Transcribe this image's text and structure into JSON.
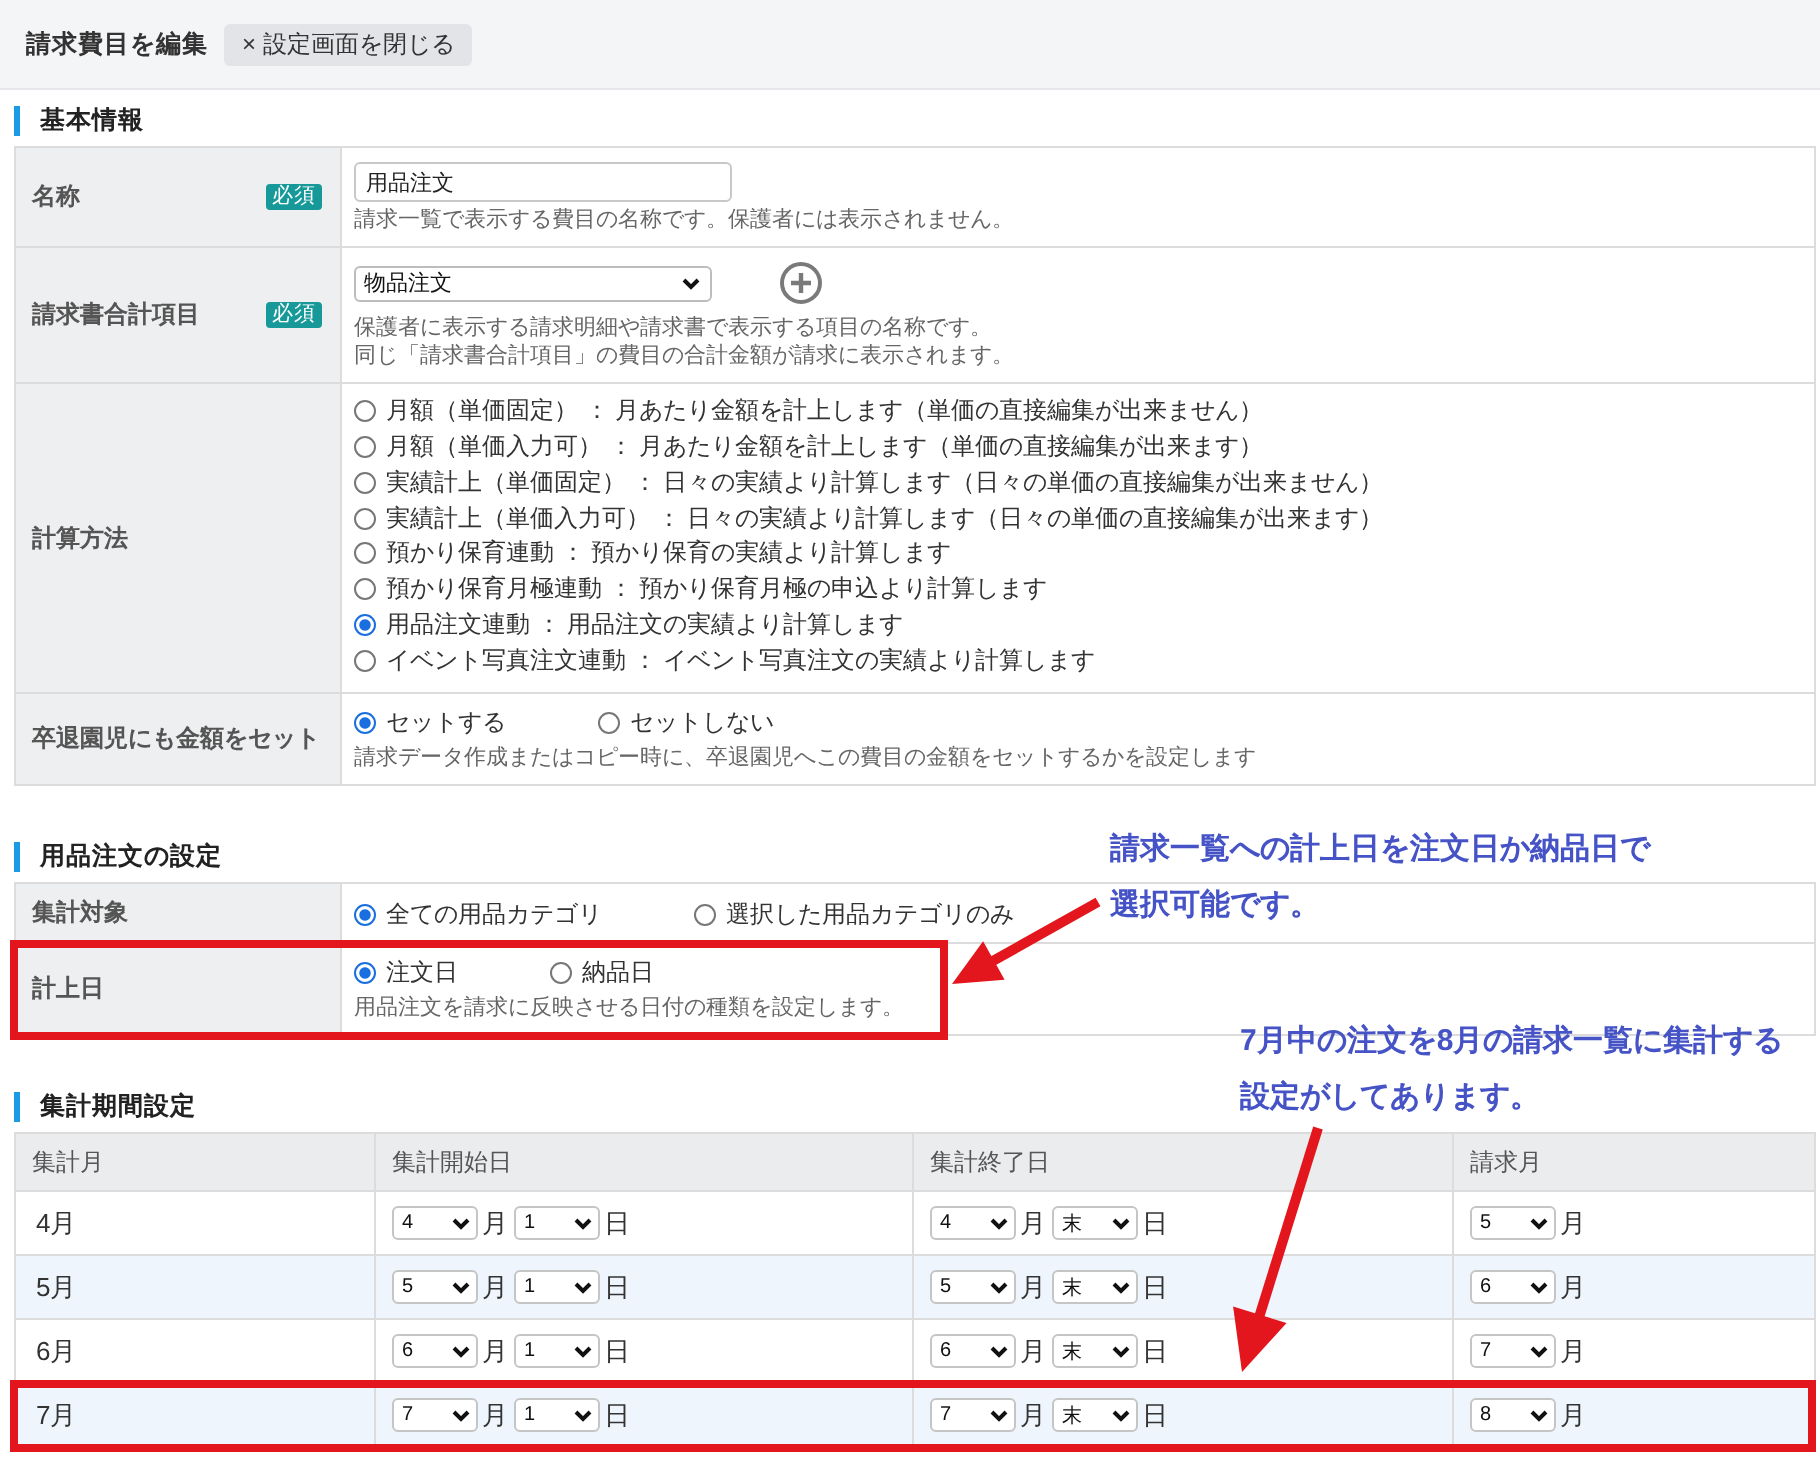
{
  "header": {
    "title": "請求費目を編集",
    "close_button": "× 設定画面を閉じる"
  },
  "sections": [
    {
      "title": "基本情報",
      "kind": "form",
      "rows": [
        {
          "kind": "input",
          "label": "名称",
          "badge": "必須",
          "value": "用品注文",
          "hint": [
            "請求一覧で表示する費目の名称です。保護者には表示されません。"
          ],
          "highlighted": false
        },
        {
          "kind": "select",
          "label": "請求書合計項目",
          "badge": "必須",
          "value": "物品注文",
          "add_button": true,
          "hint": [
            "保護者に表示する請求明細や請求書で表示する項目の名称です。",
            "同じ「請求書合計項目」の費目の合計金額が請求に表示されます。"
          ],
          "highlighted": false
        },
        {
          "kind": "radio_list",
          "label": "計算方法",
          "options": [
            {
              "label": "月額（単価固定） ： 月あたり金額を計上します（単価の直接編集が出来ません）",
              "selected": false
            },
            {
              "label": "月額（単価入力可） ： 月あたり金額を計上します（単価の直接編集が出来ます）",
              "selected": false
            },
            {
              "label": "実績計上（単価固定） ： 日々の実績より計算します（日々の単価の直接編集が出来ません）",
              "selected": false
            },
            {
              "label": "実績計上（単価入力可） ： 日々の実績より計算します（日々の単価の直接編集が出来ます）",
              "selected": false
            },
            {
              "label": "預かり保育連動 ： 預かり保育の実績より計算します",
              "selected": false
            },
            {
              "label": "預かり保育月極連動 ： 預かり保育月極の申込より計算します",
              "selected": false
            },
            {
              "label": "用品注文連動 ： 用品注文の実績より計算します",
              "selected": true
            },
            {
              "label": "イベント写真注文連動 ： イベント写真注文の実績より計算します",
              "selected": false
            }
          ],
          "highlighted": false
        },
        {
          "kind": "radio_inline",
          "label": "卒退園児にも金額をセット",
          "options": [
            {
              "label": "セットする",
              "selected": true
            },
            {
              "label": "セットしない",
              "selected": false
            }
          ],
          "hint": [
            "請求データ作成またはコピー時に、卒退園児へこの費目の金額をセットするかを設定します"
          ],
          "highlighted": false
        }
      ]
    },
    {
      "title": "用品注文の設定",
      "kind": "form",
      "rows": [
        {
          "kind": "radio_inline",
          "label": "集計対象",
          "options": [
            {
              "label": "全ての用品カテゴリ",
              "selected": true
            },
            {
              "label": "選択した用品カテゴリのみ",
              "selected": false
            }
          ],
          "highlighted": false
        },
        {
          "kind": "radio_inline",
          "label": "計上日",
          "options": [
            {
              "label": "注文日",
              "selected": true
            },
            {
              "label": "納品日",
              "selected": false
            }
          ],
          "hint": [
            "用品注文を請求に反映させる日付の種類を設定します。"
          ],
          "highlighted": true
        }
      ]
    },
    {
      "title": "集計期間設定",
      "kind": "period_table",
      "columns": [
        "集計月",
        "集計開始日",
        "集計終了日",
        "請求月"
      ],
      "rows": [
        {
          "month": "4月",
          "start": {
            "month": "4",
            "month_unit": "月",
            "day": "1",
            "day_unit": "日"
          },
          "end": {
            "month": "4",
            "month_unit": "月",
            "day": "末",
            "day_unit": "日"
          },
          "billing": {
            "month": "5",
            "month_unit": "月"
          },
          "highlighted": false
        },
        {
          "month": "5月",
          "start": {
            "month": "5",
            "month_unit": "月",
            "day": "1",
            "day_unit": "日"
          },
          "end": {
            "month": "5",
            "month_unit": "月",
            "day": "末",
            "day_unit": "日"
          },
          "billing": {
            "month": "6",
            "month_unit": "月"
          },
          "highlighted": false
        },
        {
          "month": "6月",
          "start": {
            "month": "6",
            "month_unit": "月",
            "day": "1",
            "day_unit": "日"
          },
          "end": {
            "month": "6",
            "month_unit": "月",
            "day": "末",
            "day_unit": "日"
          },
          "billing": {
            "month": "7",
            "month_unit": "月"
          },
          "highlighted": false
        },
        {
          "month": "7月",
          "start": {
            "month": "7",
            "month_unit": "月",
            "day": "1",
            "day_unit": "日"
          },
          "end": {
            "month": "7",
            "month_unit": "月",
            "day": "末",
            "day_unit": "日"
          },
          "billing": {
            "month": "8",
            "month_unit": "月"
          },
          "highlighted": true
        }
      ]
    }
  ],
  "callouts": [
    {
      "lines": [
        "請求一覧への計上日を注文日か納品日で",
        "選択可能です。"
      ]
    },
    {
      "lines": [
        "7月中の注文を8月の請求一覧に集計する",
        "設定がしてあります。"
      ]
    }
  ]
}
